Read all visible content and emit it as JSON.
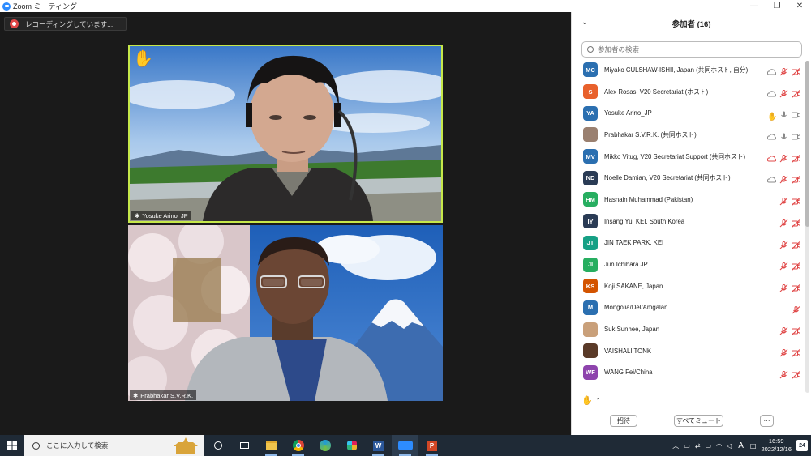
{
  "window": {
    "title": "Zoom ミーティング",
    "min": "—",
    "max": "❐",
    "close": "✕"
  },
  "recording": {
    "label": "レコーディングしています..."
  },
  "tiles": [
    {
      "name": "Yosuke Arino_JP",
      "raised_hand": true
    },
    {
      "name": "Prabhakar S.V.R.K."
    }
  ],
  "panel": {
    "title": "参加者 (16)",
    "search_placeholder": "参加者の検索",
    "participants": [
      {
        "initials": "MC",
        "color": "#2b6fb0",
        "name": "Miyako CULSHAW-ISHII, Japan (共同ホスト, 自分)",
        "icons": [
          "cloud",
          "mute",
          "video-off"
        ]
      },
      {
        "initials": "S",
        "color": "#e8612c",
        "name": "Alex Rosas, V20 Secretariat (ホスト)",
        "icons": [
          "cloud",
          "mute",
          "video-off"
        ]
      },
      {
        "initials": "YA",
        "color": "#2b6fb0",
        "name": "Yosuke Arino_JP",
        "icons": [
          "hand",
          "mic",
          "video"
        ]
      },
      {
        "initials": "",
        "color": "#9a8070",
        "name": "Prabhakar S.V.R.K. (共同ホスト)",
        "icons": [
          "cloud",
          "mic",
          "video"
        ]
      },
      {
        "initials": "MV",
        "color": "#2b6fb0",
        "name": "Mikko Vitug, V20 Secretariat Support (共同ホスト)",
        "icons": [
          "cloud-red",
          "mute",
          "video-off"
        ]
      },
      {
        "initials": "ND",
        "color": "#2a3b55",
        "name": "Noelle Damian, V20 Secretariat (共同ホスト)",
        "icons": [
          "cloud",
          "mute",
          "video-off"
        ]
      },
      {
        "initials": "HM",
        "color": "#27ae60",
        "name": "Hasnain Muhammad (Pakistan)",
        "icons": [
          "mute",
          "video-off"
        ]
      },
      {
        "initials": "IY",
        "color": "#2a3b55",
        "name": "Insang Yu, KEI, South Korea",
        "icons": [
          "mute",
          "video-off"
        ]
      },
      {
        "initials": "JT",
        "color": "#16a085",
        "name": "JIN TAEK PARK, KEI",
        "icons": [
          "mute",
          "video-off"
        ]
      },
      {
        "initials": "JI",
        "color": "#27ae60",
        "name": "Jun Ichihara JP",
        "icons": [
          "mute",
          "video-off"
        ]
      },
      {
        "initials": "KS",
        "color": "#d35400",
        "name": "Koji SAKANE, Japan",
        "icons": [
          "mute",
          "video-off"
        ]
      },
      {
        "initials": "M",
        "color": "#2b6fb0",
        "name": "Mongolia/Del/Amgalan",
        "icons": [
          "mute"
        ]
      },
      {
        "initials": "",
        "color": "#c9a07a",
        "name": "Suk Sunhee, Japan",
        "icons": [
          "mute",
          "video-off"
        ]
      },
      {
        "initials": "",
        "color": "#5a3a28",
        "name": "VAISHALI TONK",
        "icons": [
          "mute",
          "video-off"
        ]
      },
      {
        "initials": "WF",
        "color": "#8e44ad",
        "name": "WANG Fei/China",
        "icons": [
          "mute",
          "video-off"
        ]
      }
    ],
    "raised_hands_count": "1",
    "invite_label": "招待",
    "mute_all_label": "すべてミュート",
    "more_label": "···"
  },
  "taskbar": {
    "search_placeholder": "ここに入力して検索",
    "apps": [
      "task-view",
      "file-explorer",
      "chrome",
      "webex",
      "slack",
      "word",
      "zoom",
      "powerpoint"
    ],
    "ime": "A",
    "time": "16:59",
    "date": "2022/12/16",
    "notifications": "24"
  },
  "colors": {
    "active_speaker": "#c6e84a",
    "accent": "#2d8cff",
    "mute_red": "#e04848"
  }
}
